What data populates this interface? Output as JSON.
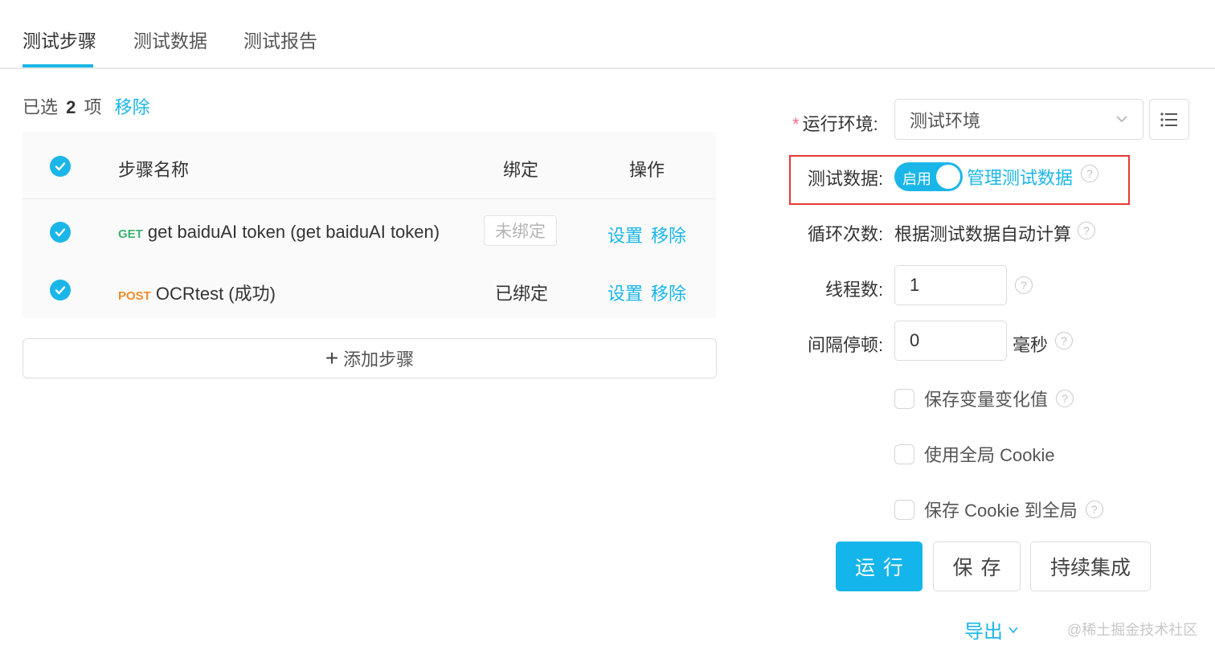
{
  "tabs": [
    {
      "label": "测试步骤",
      "active": true
    },
    {
      "label": "测试数据",
      "active": false
    },
    {
      "label": "测试报告",
      "active": false
    }
  ],
  "selection": {
    "prefix": "已选",
    "count": "2",
    "suffix": "项",
    "remove": "移除"
  },
  "table": {
    "headers": {
      "name": "步骤名称",
      "bind": "绑定",
      "ops": "操作"
    },
    "rows": [
      {
        "method": "GET",
        "name": "get baiduAI token (get baiduAI token)",
        "bind": "未绑定",
        "bound": false,
        "ops": [
          "设置",
          "移除"
        ]
      },
      {
        "method": "POST",
        "name": "OCRtest (成功)",
        "bind": "已绑定",
        "bound": true,
        "ops": [
          "设置",
          "移除"
        ]
      }
    ]
  },
  "add_step": {
    "label": "添加步骤"
  },
  "form": {
    "env_label": "运行环境:",
    "env_value": "测试环境",
    "data_label": "测试数据:",
    "toggle_text": "启用",
    "manage_link": "管理测试数据",
    "loop_label": "循环次数:",
    "loop_value": "根据测试数据自动计算",
    "threads_label": "线程数:",
    "threads_value": "1",
    "interval_label": "间隔停顿:",
    "interval_value": "0",
    "interval_unit": "毫秒",
    "checkboxes": [
      {
        "label": "保存变量变化值",
        "help": true
      },
      {
        "label": "使用全局 Cookie",
        "help": false
      },
      {
        "label": "保存 Cookie 到全局",
        "help": true
      }
    ]
  },
  "buttons": {
    "run": "运行",
    "save": "保存",
    "ci": "持续集成"
  },
  "export": {
    "label": "导出"
  },
  "watermark": "@稀土掘金技术社区",
  "colors": {
    "accent": "#1bb6e8",
    "highlight_box": "#e53935",
    "get": "#3cb371",
    "post": "#f08c2c"
  }
}
